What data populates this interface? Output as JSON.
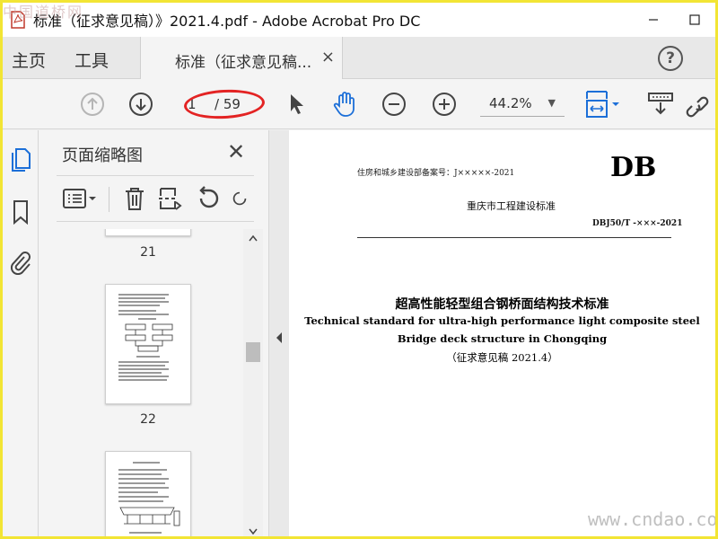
{
  "window": {
    "title": "标准（征求意见稿）》2021.4.pdf - Adobe Acrobat Pro DC",
    "watermark_top": "中国道桥网",
    "watermark_bottom": "www.cndao.com"
  },
  "menu": {
    "home": "主页",
    "tools": "工具",
    "doc_tab": "标准（征求意见稿...",
    "doc_tab_close": "×",
    "help": "?"
  },
  "toolbar": {
    "page_current": "1",
    "page_total": "/ 59",
    "zoom": "44.2%",
    "zoom_arrow": "▼",
    "icons": [
      "prev-page-icon",
      "next-page-icon",
      "select-cursor-icon",
      "hand-icon",
      "zoom-out-icon",
      "zoom-in-icon",
      "fit-page-icon",
      "scroll-mode-icon",
      "share-link-icon"
    ],
    "accent": "#1c6fd8"
  },
  "panel": {
    "title": "页面缩略图",
    "close": "✕",
    "thumbnails": [
      {
        "number": "21"
      },
      {
        "number": "22"
      }
    ]
  },
  "document": {
    "header_left": "住房和城乡建设部备案号：J×××××-2021",
    "header_right": "DB",
    "subtitle": "重庆市工程建设标准",
    "code": "DBJ50/T -×××-2021",
    "title_cn": "超高性能轻型组合钢桥面结构技术标准",
    "title_en_1": "Technical standard for ultra-high performance light composite steel",
    "title_en_2": "Bridge deck structure in Chongqing",
    "draft_note": "（征求意见稿 2021.4）"
  }
}
